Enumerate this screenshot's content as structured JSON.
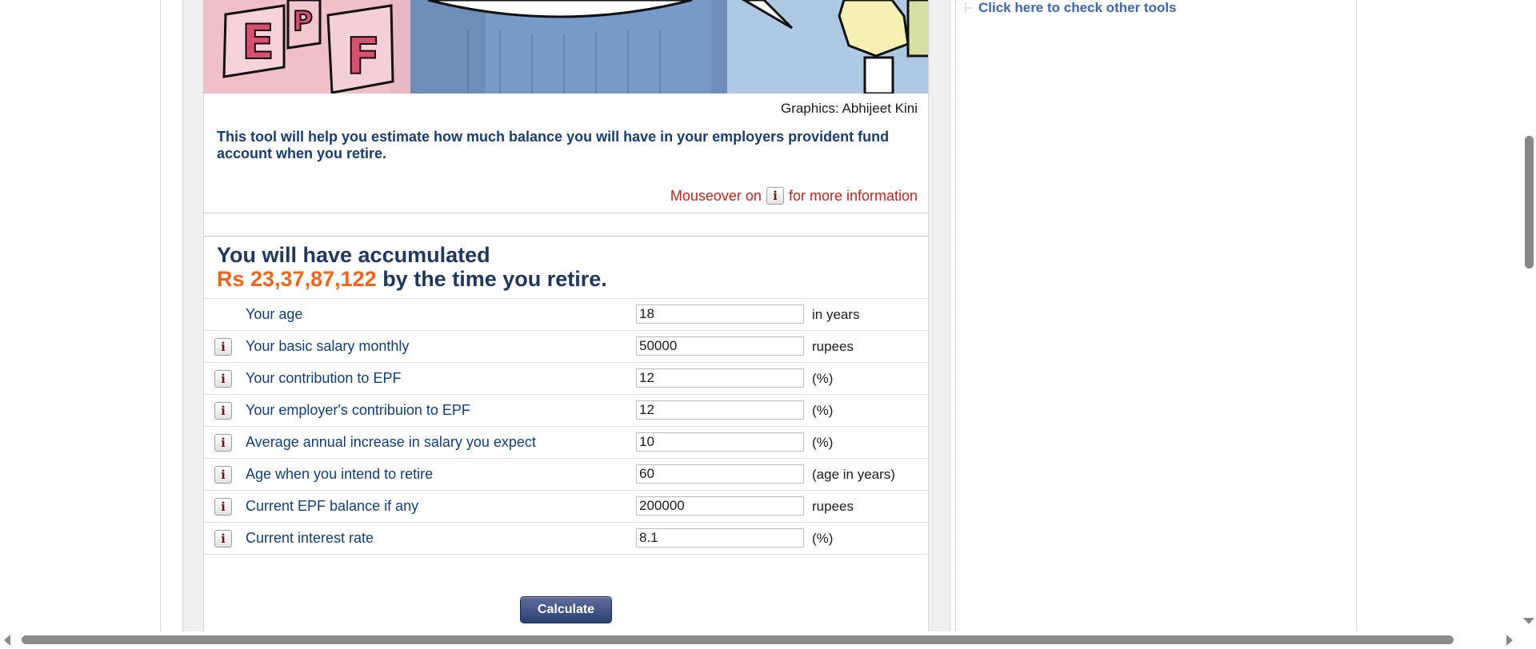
{
  "banner": {
    "credit": "Graphics: Abhijeet Kini",
    "letters": [
      "E",
      "P",
      "F"
    ]
  },
  "intro": {
    "text": "This tool will help you estimate how much balance you will have in your employers provident fund account when you retire."
  },
  "mouseover_note": {
    "before": "Mouseover on",
    "icon": "i",
    "after": "for more information"
  },
  "result": {
    "line1": "You will have accumulated",
    "amount": "Rs 23,37,87,122",
    "line2_suffix": "by the time you retire."
  },
  "form": {
    "rows": [
      {
        "label": "Your age",
        "value": "18",
        "unit": "in years",
        "info_icon": false
      },
      {
        "label": "Your basic salary monthly",
        "value": "50000",
        "unit": "rupees",
        "info_icon": true
      },
      {
        "label": "Your contribution to EPF",
        "value": "12",
        "unit": "(%)",
        "info_icon": true
      },
      {
        "label": "Your employer's contribuion to EPF",
        "value": "12",
        "unit": "(%)",
        "info_icon": true
      },
      {
        "label": "Average annual increase in salary you expect",
        "value": "10",
        "unit": "(%)",
        "info_icon": true
      },
      {
        "label": "Age when you intend to retire",
        "value": "60",
        "unit": "(age in years)",
        "info_icon": true
      },
      {
        "label": "Current EPF balance if any",
        "value": "200000",
        "unit": "rupees",
        "info_icon": true
      },
      {
        "label": "Current interest rate",
        "value": "8.1",
        "unit": "(%)",
        "info_icon": true
      }
    ],
    "info_icon_glyph": "i",
    "calculate_label": "Calculate"
  },
  "sidebar": {
    "link_text": "Click here to check other tools"
  },
  "colors": {
    "heading_blue": "#1f365d",
    "label_blue": "#0f3f79",
    "accent_orange": "#ef6416",
    "note_red": "#c7221a",
    "link_blue": "#3867b0"
  },
  "icons": {
    "info": "info-icon",
    "tree": "tree-node-icon"
  }
}
